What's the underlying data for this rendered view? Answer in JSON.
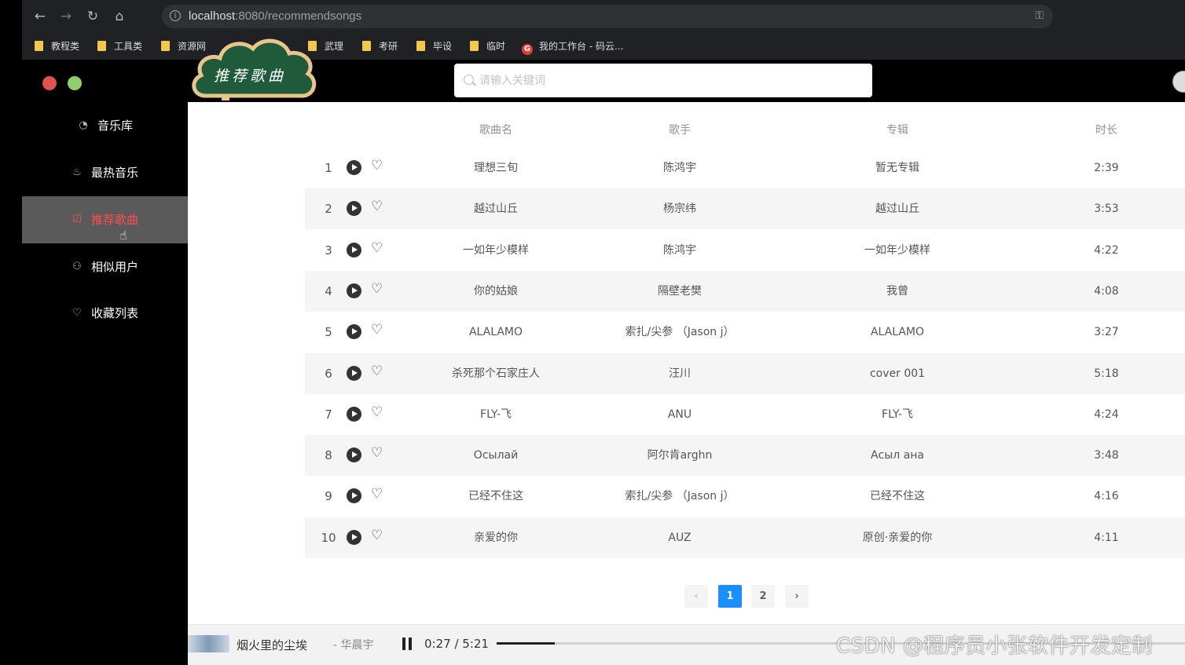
{
  "browser": {
    "url_host": "localhost",
    "url_rest": ":8080/recommendsongs",
    "bookmarks": [
      "教程类",
      "工具类",
      "资源网",
      "武理",
      "考研",
      "毕设",
      "临时",
      "我的工作台 - 码云..."
    ]
  },
  "logo": {
    "text": "推荐歌曲"
  },
  "sidebar": {
    "items": [
      {
        "label": "音乐库",
        "icon": "music-disc-icon"
      },
      {
        "label": "最热音乐",
        "icon": "fire-icon"
      },
      {
        "label": "推荐歌曲",
        "icon": "recommend-icon",
        "active": true
      },
      {
        "label": "相似用户",
        "icon": "user-icon"
      },
      {
        "label": "收藏列表",
        "icon": "heart-icon"
      }
    ]
  },
  "search": {
    "placeholder": "请输入关键词"
  },
  "table": {
    "headers": {
      "name": "歌曲名",
      "artist": "歌手",
      "album": "专辑",
      "duration": "时长"
    },
    "rows": [
      {
        "idx": "1",
        "name": "理想三旬",
        "artist": "陈鸿宇",
        "album": "暂无专辑",
        "duration": "2:39"
      },
      {
        "idx": "2",
        "name": "越过山丘",
        "artist": "杨宗纬",
        "album": "越过山丘",
        "duration": "3:53"
      },
      {
        "idx": "3",
        "name": "一如年少模样",
        "artist": "陈鸿宇",
        "album": "一如年少模样",
        "duration": "4:22"
      },
      {
        "idx": "4",
        "name": "你的姑娘",
        "artist": "隔壁老樊",
        "album": "我曾",
        "duration": "4:08"
      },
      {
        "idx": "5",
        "name": "ALALAMO",
        "artist": "索扎/尖参 （Jason j）",
        "album": "ALALAMO",
        "duration": "3:27"
      },
      {
        "idx": "6",
        "name": "杀死那个石家庄人",
        "artist": "汪川",
        "album": "cover 001",
        "duration": "5:18"
      },
      {
        "idx": "7",
        "name": "FLY-飞",
        "artist": "ANU",
        "album": "FLY-飞",
        "duration": "4:24"
      },
      {
        "idx": "8",
        "name": "Осылай",
        "artist": "阿尔肯arghn",
        "album": "Асыл ана",
        "duration": "3:48"
      },
      {
        "idx": "9",
        "name": "已经不住这",
        "artist": "索扎/尖参 （Jason j）",
        "album": "已经不住这",
        "duration": "4:16"
      },
      {
        "idx": "10",
        "name": "亲爱的你",
        "artist": "AUZ",
        "album": "原创·亲爱的你",
        "duration": "4:11"
      }
    ]
  },
  "pagination": {
    "prev": "‹",
    "pages": [
      "1",
      "2"
    ],
    "current": "1",
    "next": "›"
  },
  "player": {
    "title": "烟火里的尘埃",
    "artist": "- 华晨宇",
    "time": "0:27 / 5:21",
    "progress": 0.084
  },
  "watermark": "CSDN @程序员小张软件开发定制",
  "colors": {
    "accent": "#1890ff",
    "active_nav": "#ff4d4f",
    "sidebar_bg": "#000000"
  }
}
